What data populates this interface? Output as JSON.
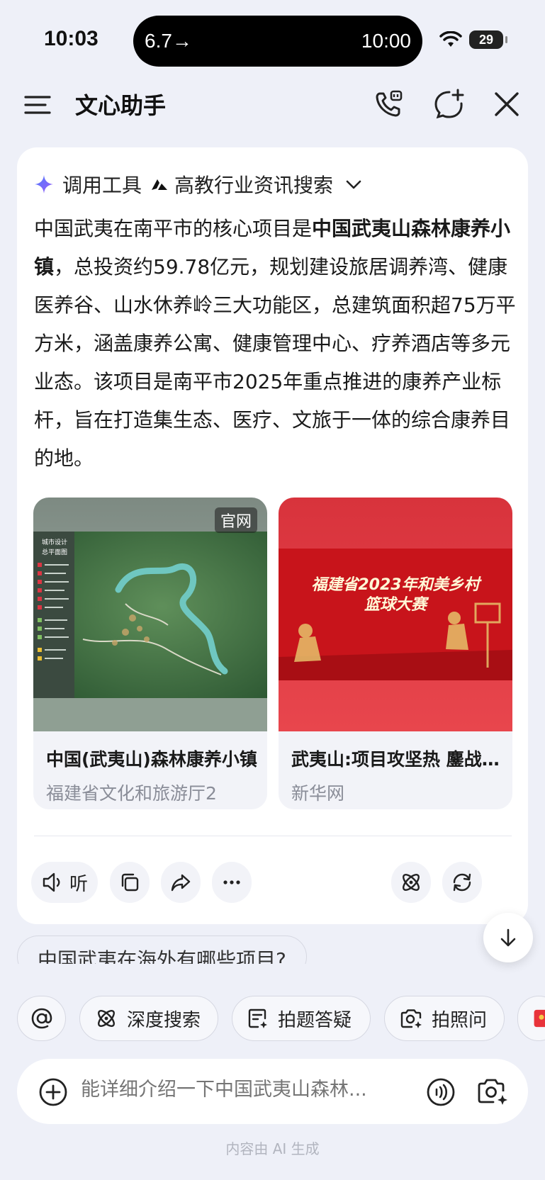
{
  "status_bar": {
    "time": "10:03",
    "pill_left": "6.7→",
    "pill_right": "10:00",
    "battery": "29"
  },
  "header": {
    "title": "文心助手",
    "icons": [
      "menu-icon",
      "phone-call-icon",
      "new-chat-icon",
      "close-icon"
    ]
  },
  "message": {
    "tool_prefix": "调用工具",
    "tool_name": "高教行业资讯搜索",
    "answer_bold_1": "中国武夷山森林康养小镇",
    "answer_part_0": "中国武夷在南平市的核心项目是",
    "answer_part_2": "，总投资约59.78亿元，规划建设旅居调养湾、健康医养谷、山水休养岭三大功能区，总建筑面积超75万平方米，涵盖康养公寓、健康管理中心、疗养酒店等多元业态。该项目是南平市2025年重点推进的康养产业标杆，旨在打造集生态、医疗、文旅于一体的综合康养目的地。",
    "sources": [
      {
        "title": "中国(武夷山)森林康养小镇",
        "source": "福建省文化和旅游厅2",
        "badge": "官网",
        "image_label": "城市设计\n总平面图"
      },
      {
        "title": "武夷山:项目攻坚热 鏖战正当时",
        "source": "新华网",
        "image_text_1": "福建省2023年和美乡村",
        "image_text_2": "篮球大赛"
      }
    ],
    "actions": {
      "listen_label": "听"
    }
  },
  "suggestion": "中国武夷在海外有哪些项目?",
  "chips": [
    {
      "label": "深度搜索",
      "icon": "deep-search-icon"
    },
    {
      "label": "拍题答疑",
      "icon": "photo-question-icon"
    },
    {
      "label": "拍照问",
      "icon": "camera-icon"
    }
  ],
  "input": {
    "placeholder": "能详细介绍一下中国武夷山森林..."
  },
  "footer": "内容由 AI 生成",
  "colors": {
    "accent": "#6b5cf6",
    "background": "#eef0f8",
    "card": "#ffffff"
  }
}
